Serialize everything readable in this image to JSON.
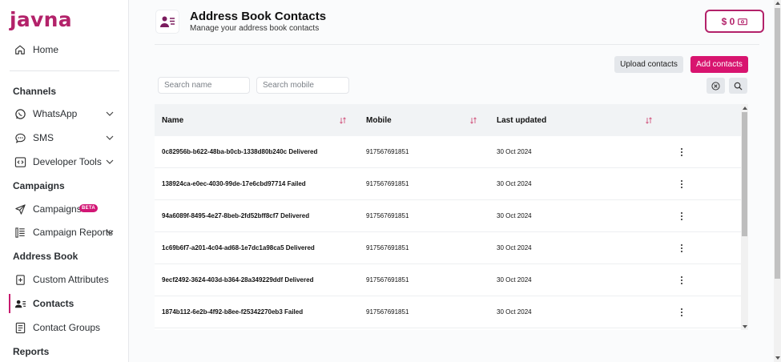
{
  "brand": {
    "logo_text": "javna",
    "accent": "#d8146f"
  },
  "sidebar": {
    "home": "Home",
    "sections": {
      "channels": "Channels",
      "campaigns": "Campaigns",
      "address_book": "Address Book",
      "reports": "Reports"
    },
    "items": {
      "whatsapp": "WhatsApp",
      "sms": "SMS",
      "developer_tools": "Developer Tools",
      "campaigns": "Campaigns",
      "campaigns_badge": "BETA",
      "campaign_reports": "Campaign Reports",
      "custom_attributes": "Custom Attributes",
      "contacts": "Contacts",
      "contact_groups": "Contact Groups"
    },
    "active_item": "Contacts"
  },
  "header": {
    "title": "Address Book Contacts",
    "subtitle": "Manage your address book contacts",
    "balance": "$ 0"
  },
  "toolbar": {
    "upload_label": "Upload contacts",
    "add_label": "Add contacts",
    "search_name_placeholder": "Search name",
    "search_mobile_placeholder": "Search mobile",
    "clear_icon": "clear-circle-icon",
    "search_icon": "search-icon"
  },
  "table": {
    "columns": [
      "Name",
      "Mobile",
      "Last updated"
    ],
    "rows": [
      {
        "name": "0c82956b-b622-48ba-b0cb-1338d80b240c Delivered",
        "mobile": "917567691851",
        "updated": "30 Oct 2024"
      },
      {
        "name": "138924ca-e0ec-4030-99de-17e6cbd97714 Failed",
        "mobile": "917567691851",
        "updated": "30 Oct 2024"
      },
      {
        "name": "94a6089f-8495-4e27-8beb-2fd52bff8cf7 Delivered",
        "mobile": "917567691851",
        "updated": "30 Oct 2024"
      },
      {
        "name": "1c69b6f7-a201-4c04-ad68-1e7dc1a98ca5 Delivered",
        "mobile": "917567691851",
        "updated": "30 Oct 2024"
      },
      {
        "name": "9ecf2492-3624-403d-b364-28a349229ddf Delivered",
        "mobile": "917567691851",
        "updated": "30 Oct 2024"
      },
      {
        "name": "1874b112-6e2b-4f92-b8ee-f25342270eb3 Failed",
        "mobile": "917567691851",
        "updated": "30 Oct 2024"
      }
    ]
  }
}
